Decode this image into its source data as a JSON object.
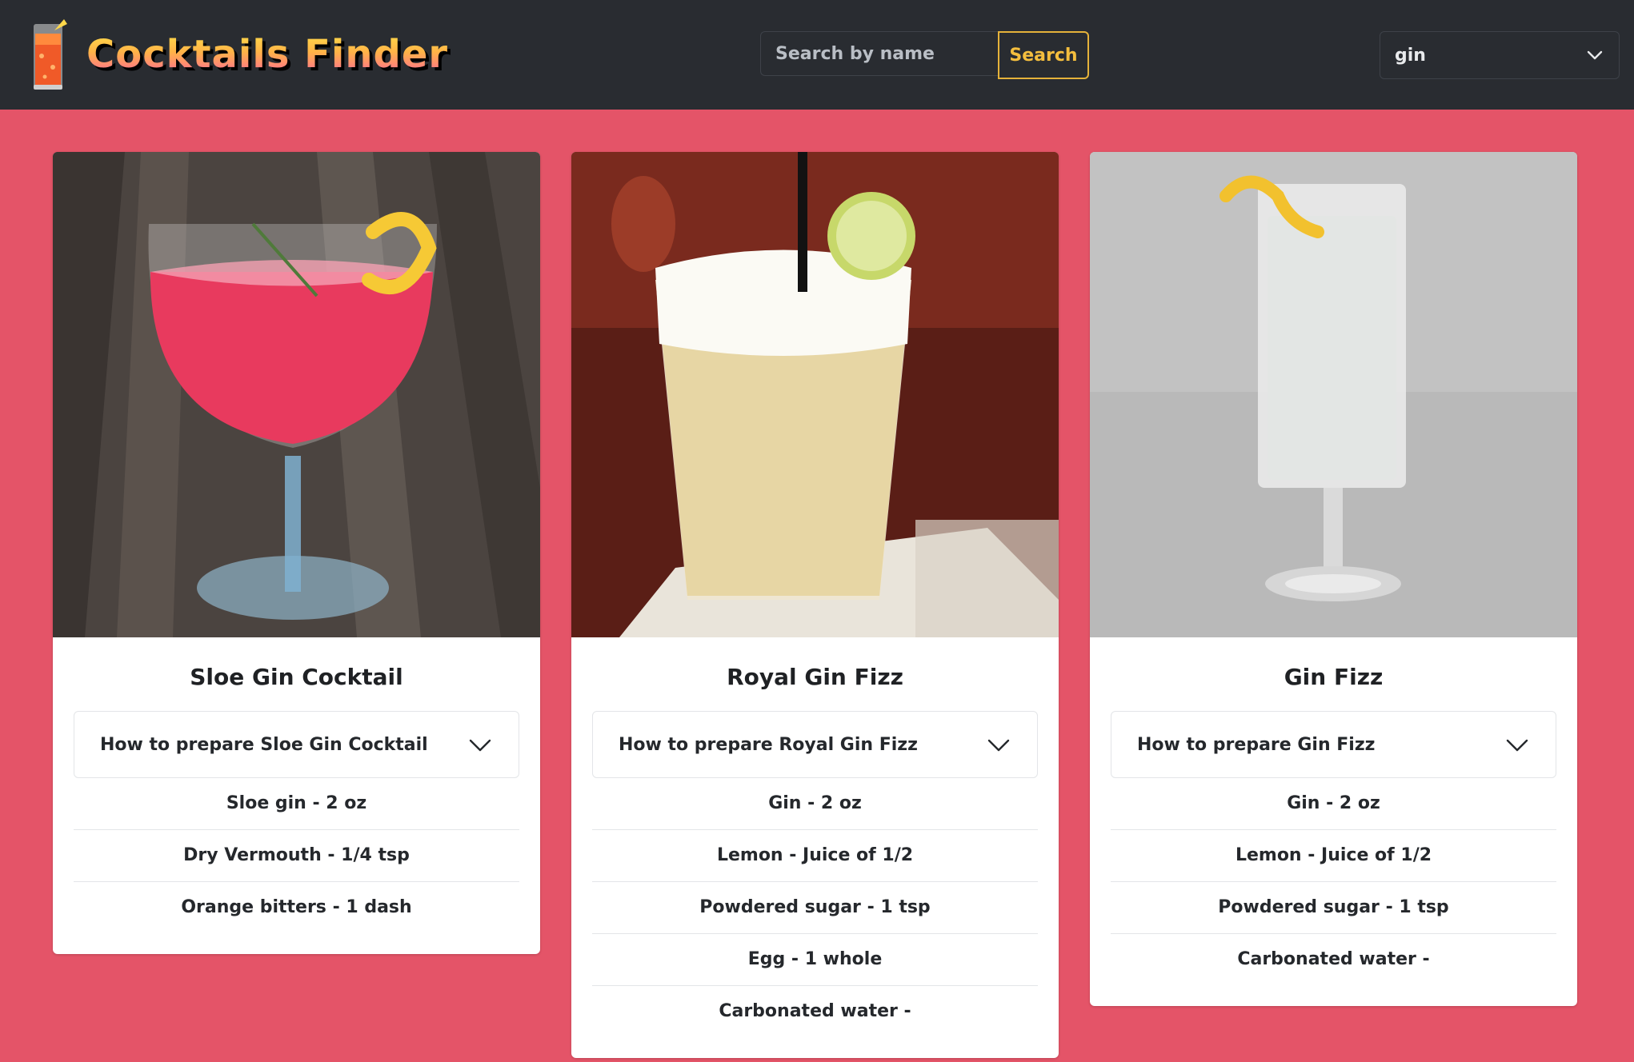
{
  "header": {
    "logo_text": "Cocktails Finder",
    "search": {
      "placeholder": "Search by name",
      "value": "",
      "button_label": "Search"
    },
    "filter": {
      "selected": "gin"
    }
  },
  "colors": {
    "background": "#e45468",
    "topbar": "#292c31",
    "accent": "#f4be3e"
  },
  "cards": [
    {
      "name": "Sloe Gin Cocktail",
      "prepare_label": "How to prepare Sloe Gin Cocktail",
      "ingredients": [
        "Sloe gin - 2 oz",
        "Dry Vermouth - 1/4 tsp",
        "Orange bitters - 1 dash"
      ]
    },
    {
      "name": "Royal Gin Fizz",
      "prepare_label": "How to prepare Royal Gin Fizz",
      "ingredients": [
        "Gin - 2 oz",
        "Lemon - Juice of 1/2",
        "Powdered sugar - 1 tsp",
        "Egg - 1 whole",
        "Carbonated water -"
      ]
    },
    {
      "name": "Gin Fizz",
      "prepare_label": "How to prepare Gin Fizz",
      "ingredients": [
        "Gin - 2 oz",
        "Lemon - Juice of 1/2",
        "Powdered sugar - 1 tsp",
        "Carbonated water -"
      ]
    }
  ]
}
